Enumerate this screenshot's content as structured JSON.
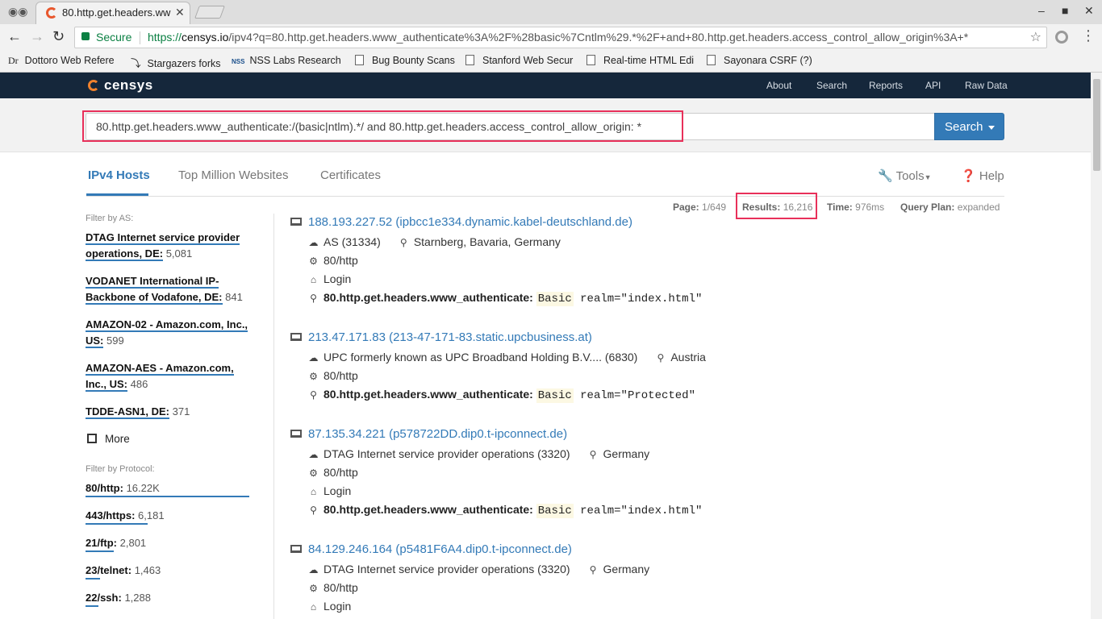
{
  "browser": {
    "tab_title": "80.http.get.headers.ww",
    "tab_close": "✕",
    "url_secure": "Secure",
    "url_scheme": "https://",
    "url_host": "censys.io",
    "url_path": "/ipv4?q=80.http.get.headers.www_authenticate%3A%2F%28basic%7Cntlm%29.*%2F+and+80.http.get.headers.access_control_allow_origin%3A+*",
    "bookmarks": [
      "Dottoro Web Refere",
      "Stargazers forks",
      "NSS Labs Research",
      "Bug Bounty Scans",
      "Stanford Web Secur",
      "Real-time HTML Edi",
      "Sayonara CSRF (?) 2"
    ],
    "bookmark_prefix_dr": "Dr",
    "bookmark_prefix_nss": "NSS"
  },
  "header": {
    "brand": "censys",
    "nav": [
      "About",
      "Search",
      "Reports",
      "API",
      "Raw Data"
    ]
  },
  "search": {
    "query": "80.http.get.headers.www_authenticate:/(basic|ntlm).*/ and 80.http.get.headers.access_control_allow_origin: *",
    "button": "Search"
  },
  "tabs": [
    "IPv4 Hosts",
    "Top Million Websites",
    "Certificates"
  ],
  "tools_label": "Tools",
  "help_label": "Help",
  "meta": {
    "page_label": "Page:",
    "page_value": "1/649",
    "results_label": "Results:",
    "results_value": "16,216",
    "time_label": "Time:",
    "time_value": "976ms",
    "plan_label": "Query Plan:",
    "plan_value": "expanded"
  },
  "sidebar": {
    "as_head": "Filter by AS:",
    "as_items": [
      {
        "name": "DTAG Internet service provider operations, DE:",
        "count": "5,081"
      },
      {
        "name": "VODANET International IP-Backbone of Vodafone, DE:",
        "count": "841"
      },
      {
        "name": "AMAZON-02 - Amazon.com, Inc., US:",
        "count": "599"
      },
      {
        "name": "AMAZON-AES - Amazon.com, Inc., US:",
        "count": "486"
      },
      {
        "name": "TDDE-ASN1, DE:",
        "count": "371"
      }
    ],
    "more": "More",
    "proto_head": "Filter by Protocol:",
    "protocols": [
      {
        "name": "80/http:",
        "count": "16.22K",
        "share": 1.0
      },
      {
        "name": "443/https:",
        "count": "6,181",
        "share": 0.38
      },
      {
        "name": "21/ftp:",
        "count": "2,801",
        "share": 0.17
      },
      {
        "name": "23/telnet:",
        "count": "1,463",
        "share": 0.09
      },
      {
        "name": "22/ssh:",
        "count": "1,288",
        "share": 0.08
      }
    ]
  },
  "results": [
    {
      "title": "188.193.227.52 (ipbcc1e334.dynamic.kabel-deutschland.de)",
      "as": "AS (31334)",
      "location": "Starnberg, Bavaria, Germany",
      "port": "80/http",
      "page": "Login",
      "match_key": "80.http.get.headers.www_authenticate:",
      "match_kw": "Basic",
      "match_rest": " realm=\"index.html\""
    },
    {
      "title": "213.47.171.83 (213-47-171-83.static.upcbusiness.at)",
      "as": "UPC formerly known as UPC Broadband Holding B.V.... (6830)",
      "location": "Austria",
      "port": "80/http",
      "page": "",
      "match_key": "80.http.get.headers.www_authenticate:",
      "match_kw": "Basic",
      "match_rest": " realm=\"Protected\""
    },
    {
      "title": "87.135.34.221 (p578722DD.dip0.t-ipconnect.de)",
      "as": "DTAG Internet service provider operations (3320)",
      "location": "Germany",
      "port": "80/http",
      "page": "Login",
      "match_key": "80.http.get.headers.www_authenticate:",
      "match_kw": "Basic",
      "match_rest": " realm=\"index.html\""
    },
    {
      "title": "84.129.246.164 (p5481F6A4.dip0.t-ipconnect.de)",
      "as": "DTAG Internet service provider operations (3320)",
      "location": "Germany",
      "port": "80/http",
      "page": "Login",
      "match_key": "",
      "match_kw": "",
      "match_rest": ""
    }
  ],
  "colors": {
    "accent": "#337ab7",
    "header_bg": "#15273b",
    "highlight_box": "#e8305a",
    "secure": "#0b8043"
  }
}
